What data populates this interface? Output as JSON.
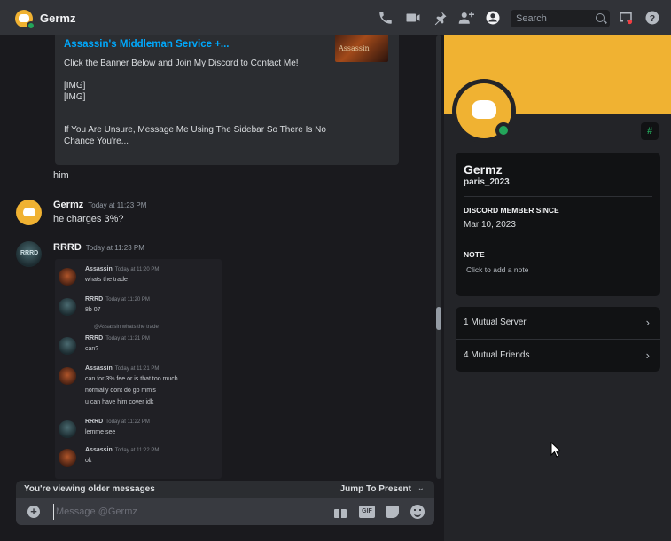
{
  "header": {
    "title": "Germz",
    "search_placeholder": "Search"
  },
  "embed": {
    "link_text": "Assassin's Middleman Service +...",
    "description": "Click the Banner Below and Join My Discord to Contact Me!\n\n[IMG]\n[IMG]\n\n\nIf You Are Unsure, Message Me Using The Sidebar So There Is No Chance You're...",
    "thumb_text": "Assassin"
  },
  "messages": [
    {
      "text": "him"
    },
    {
      "author": "Germz",
      "time": "Today at 11:23 PM",
      "text": "he charges 3%?"
    },
    {
      "author": "RRRD",
      "time": "Today at 11:23 PM",
      "avatar_text": "RRRD"
    }
  ],
  "screenshot_content": [
    {
      "author": "Assassin",
      "time": "Today at 11:20 PM",
      "lines": [
        "whats the trade"
      ]
    },
    {
      "author": "RRRD",
      "time": "Today at 11:20 PM",
      "lines": [
        "8b 07"
      ]
    },
    {
      "reply": "@Assassin whats the trade",
      "author": "RRRD",
      "time": "Today at 11:21 PM",
      "lines": [
        "can?"
      ]
    },
    {
      "author": "Assassin",
      "time": "Today at 11:21 PM",
      "lines": [
        "can for 3% fee or is that too much",
        "normally dont do gp mm's",
        "u can have him cover idk"
      ]
    },
    {
      "author": "RRRD",
      "time": "Today at 11:22 PM",
      "lines": [
        "lemme see"
      ]
    },
    {
      "author": "Assassin",
      "time": "Today at 11:22 PM",
      "lines": [
        "ok"
      ]
    }
  ],
  "older_bar": {
    "notice": "You're viewing older messages",
    "jump": "Jump To Present"
  },
  "composer": {
    "placeholder": "Message @Germz",
    "gif_label": "GIF"
  },
  "profile": {
    "display_name": "Germz",
    "username": "paris_2023",
    "member_since_heading": "DISCORD MEMBER SINCE",
    "member_since": "Mar 10, 2023",
    "note_heading": "NOTE",
    "note_placeholder": "Click to add a note",
    "badge": "#",
    "mutual_servers": "1 Mutual Server",
    "mutual_friends": "4 Mutual Friends"
  },
  "colors": {
    "banner": "#f0b232",
    "online": "#23a55a",
    "link": "#00a8fc"
  },
  "icons": [
    "voice-call-icon",
    "video-call-icon",
    "pin-icon",
    "add-friend-icon",
    "user-profile-icon",
    "inbox-icon",
    "help-icon",
    "add-attachment-icon",
    "gift-icon",
    "gif-icon",
    "sticker-icon",
    "emoji-icon",
    "chevron-right-icon"
  ]
}
